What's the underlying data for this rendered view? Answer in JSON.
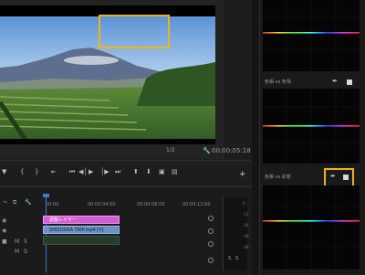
{
  "monitor": {
    "fraction": "1/2",
    "timecode": "00:00:05:18",
    "wrench_icon": "wrench-icon"
  },
  "transport": {
    "buttons": [
      "mark-in",
      "mark-out",
      "go-to-in",
      "step-back",
      "play",
      "step-forward",
      "go-to-out",
      "lift",
      "extract",
      "export-frame",
      "compare"
    ]
  },
  "timeline": {
    "ruler_labels": [
      "00:00",
      "00:00:04:00",
      "00:00:08:00",
      "00:00:12:00"
    ],
    "tracks": [
      {
        "name": "V3"
      },
      {
        "name": "V2"
      },
      {
        "name": "V1"
      },
      {
        "name": "A1"
      }
    ],
    "track_letters": [
      "M",
      "S"
    ],
    "clips": {
      "adjustment": "調整レイヤー",
      "video": "SHIZUOKA TRIP.mp4 [V]"
    }
  },
  "meter": {
    "labels": [
      "S",
      "S"
    ],
    "ticks": [
      "0",
      "-12",
      "-24",
      "-36",
      "-48"
    ]
  },
  "scopes": {
    "panel2_title": "色相 vs 色相",
    "panel3_title": "色相 vs 彩度"
  },
  "colors": {
    "highlight": "#f0b21a",
    "playhead": "#3a7bd5",
    "adjustment_clip": "#d55ed4",
    "video_clip": "#6a92c8"
  }
}
